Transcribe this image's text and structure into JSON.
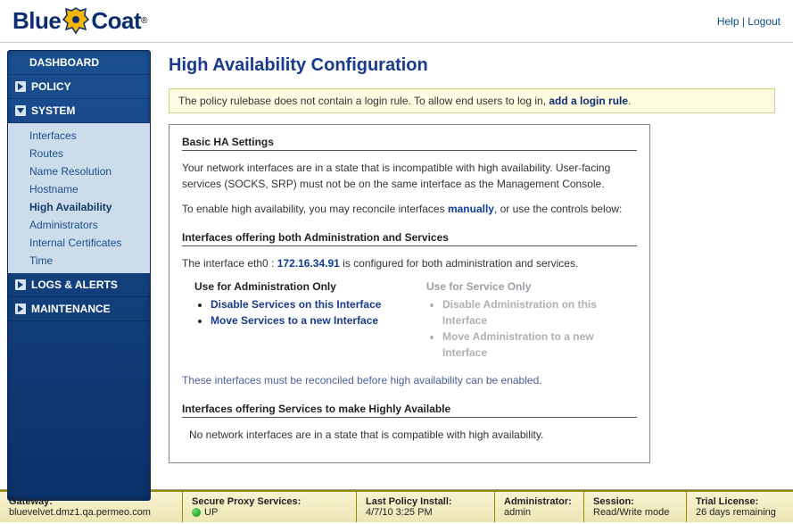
{
  "top": {
    "brand_a": "Blue",
    "brand_b": "Coat",
    "reg": "®",
    "help": "Help",
    "logout": "Logout"
  },
  "nav": {
    "dashboard": "DASHBOARD",
    "policy": "POLICY",
    "system": "SYSTEM",
    "logs": "LOGS & ALERTS",
    "maintenance": "MAINTENANCE",
    "system_items": {
      "interfaces": "Interfaces",
      "routes": "Routes",
      "name_res": "Name Resolution",
      "hostname": "Hostname",
      "ha": "High Availability",
      "admins": "Administrators",
      "int_certs": "Internal Certificates",
      "time": "Time"
    }
  },
  "page": {
    "title": "High Availability Configuration",
    "alert_pre": "The policy rulebase does not contain a login rule. To allow end users to log in, ",
    "alert_link": "add a login rule",
    "alert_post": ".",
    "basic": {
      "heading": "Basic HA Settings",
      "p1": "Your network interfaces are in a state that is incompatible with high availability. User-facing services (SOCKS, SRP) must not be on the same interface as the Management Console.",
      "p2a": "To enable high availability, you may reconcile interfaces ",
      "p2_link": "manually",
      "p2b": ", or use the controls below:"
    },
    "both": {
      "heading": "Interfaces offering both Administration and Services",
      "line_a": "The interface eth0 : ",
      "ip": "172.16.34.91",
      "line_b": " is configured for both administration and services.",
      "admin_hdr": "Use for Administration Only",
      "svc_hdr": "Use for Service Only",
      "admin_opt1": "Disable Services on this Interface",
      "admin_opt2": "Move Services to a new Interface",
      "svc_opt1": "Disable Administration on this Interface",
      "svc_opt2": "Move Administration to a new Interface",
      "note": "These interfaces must be reconciled before high availability can be enabled."
    },
    "svc_ha": {
      "heading": "Interfaces offering Services to make Highly Available",
      "body": "No network interfaces are in a state that is compatible with high availability."
    }
  },
  "status": {
    "gateway_lbl": "Gateway:",
    "gateway_val": "bluevelvet.dmz1.qa.permeo.com",
    "sps_lbl": "Secure Proxy Services:",
    "sps_val": "UP",
    "lpi_lbl": "Last Policy Install:",
    "lpi_val": "4/7/10 3:25 PM",
    "admin_lbl": "Administrator:",
    "admin_val": "admin",
    "sess_lbl": "Session:",
    "sess_val": "Read/Write mode",
    "lic_lbl": "Trial License:",
    "lic_val": "26 days remaining"
  }
}
